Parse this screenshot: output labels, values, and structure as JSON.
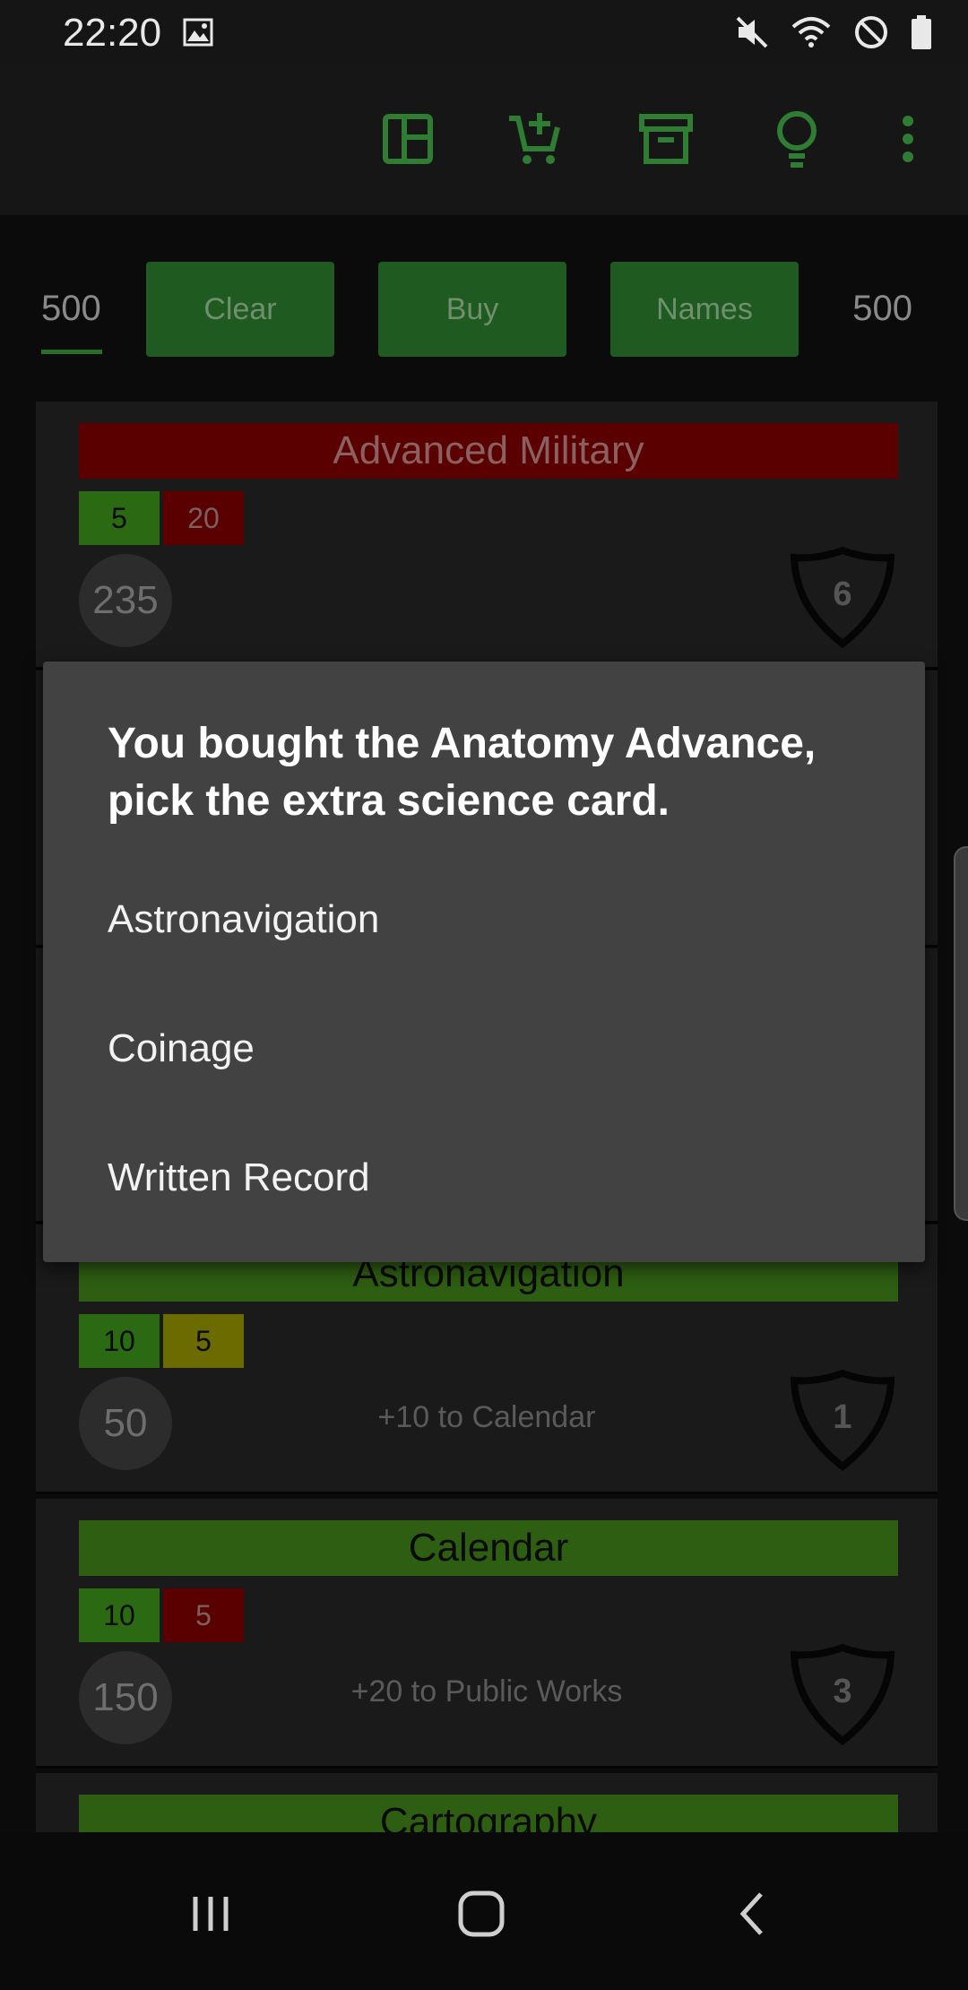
{
  "status_bar": {
    "time": "22:20",
    "icons": [
      "image-icon",
      "mute-icon",
      "wifi-icon",
      "blocked-icon",
      "battery-icon"
    ]
  },
  "app_bar": {
    "icons": [
      "layout-icon",
      "add-cart-icon",
      "archive-icon",
      "lightbulb-icon",
      "more-vert-icon"
    ],
    "accent_color": "#2e7d32"
  },
  "controls": {
    "left_count": "500",
    "clear_label": "Clear",
    "buy_label": "Buy",
    "names_label": "Names",
    "right_count": "500"
  },
  "cards": [
    {
      "title": "Advanced Military",
      "chip1": "5",
      "chip2": "20",
      "cost": "235",
      "bonus": "",
      "shield": "6"
    },
    {
      "title": "Astronavigation",
      "chip1": "10",
      "chip2": "5",
      "cost": "50",
      "bonus": "+10 to Calendar",
      "shield": "1"
    },
    {
      "title": "Calendar",
      "chip1": "10",
      "chip2": "5",
      "cost": "150",
      "bonus": "+20 to Public Works",
      "shield": "3"
    },
    {
      "title": "Cartography"
    }
  ],
  "dialog": {
    "title": "You bought the Anatomy Advance, pick the extra science card.",
    "options": [
      "Astronavigation",
      "Coinage",
      "Written Record"
    ]
  },
  "nav_bar": {
    "icons": [
      "recents-icon",
      "home-icon",
      "back-icon"
    ]
  }
}
